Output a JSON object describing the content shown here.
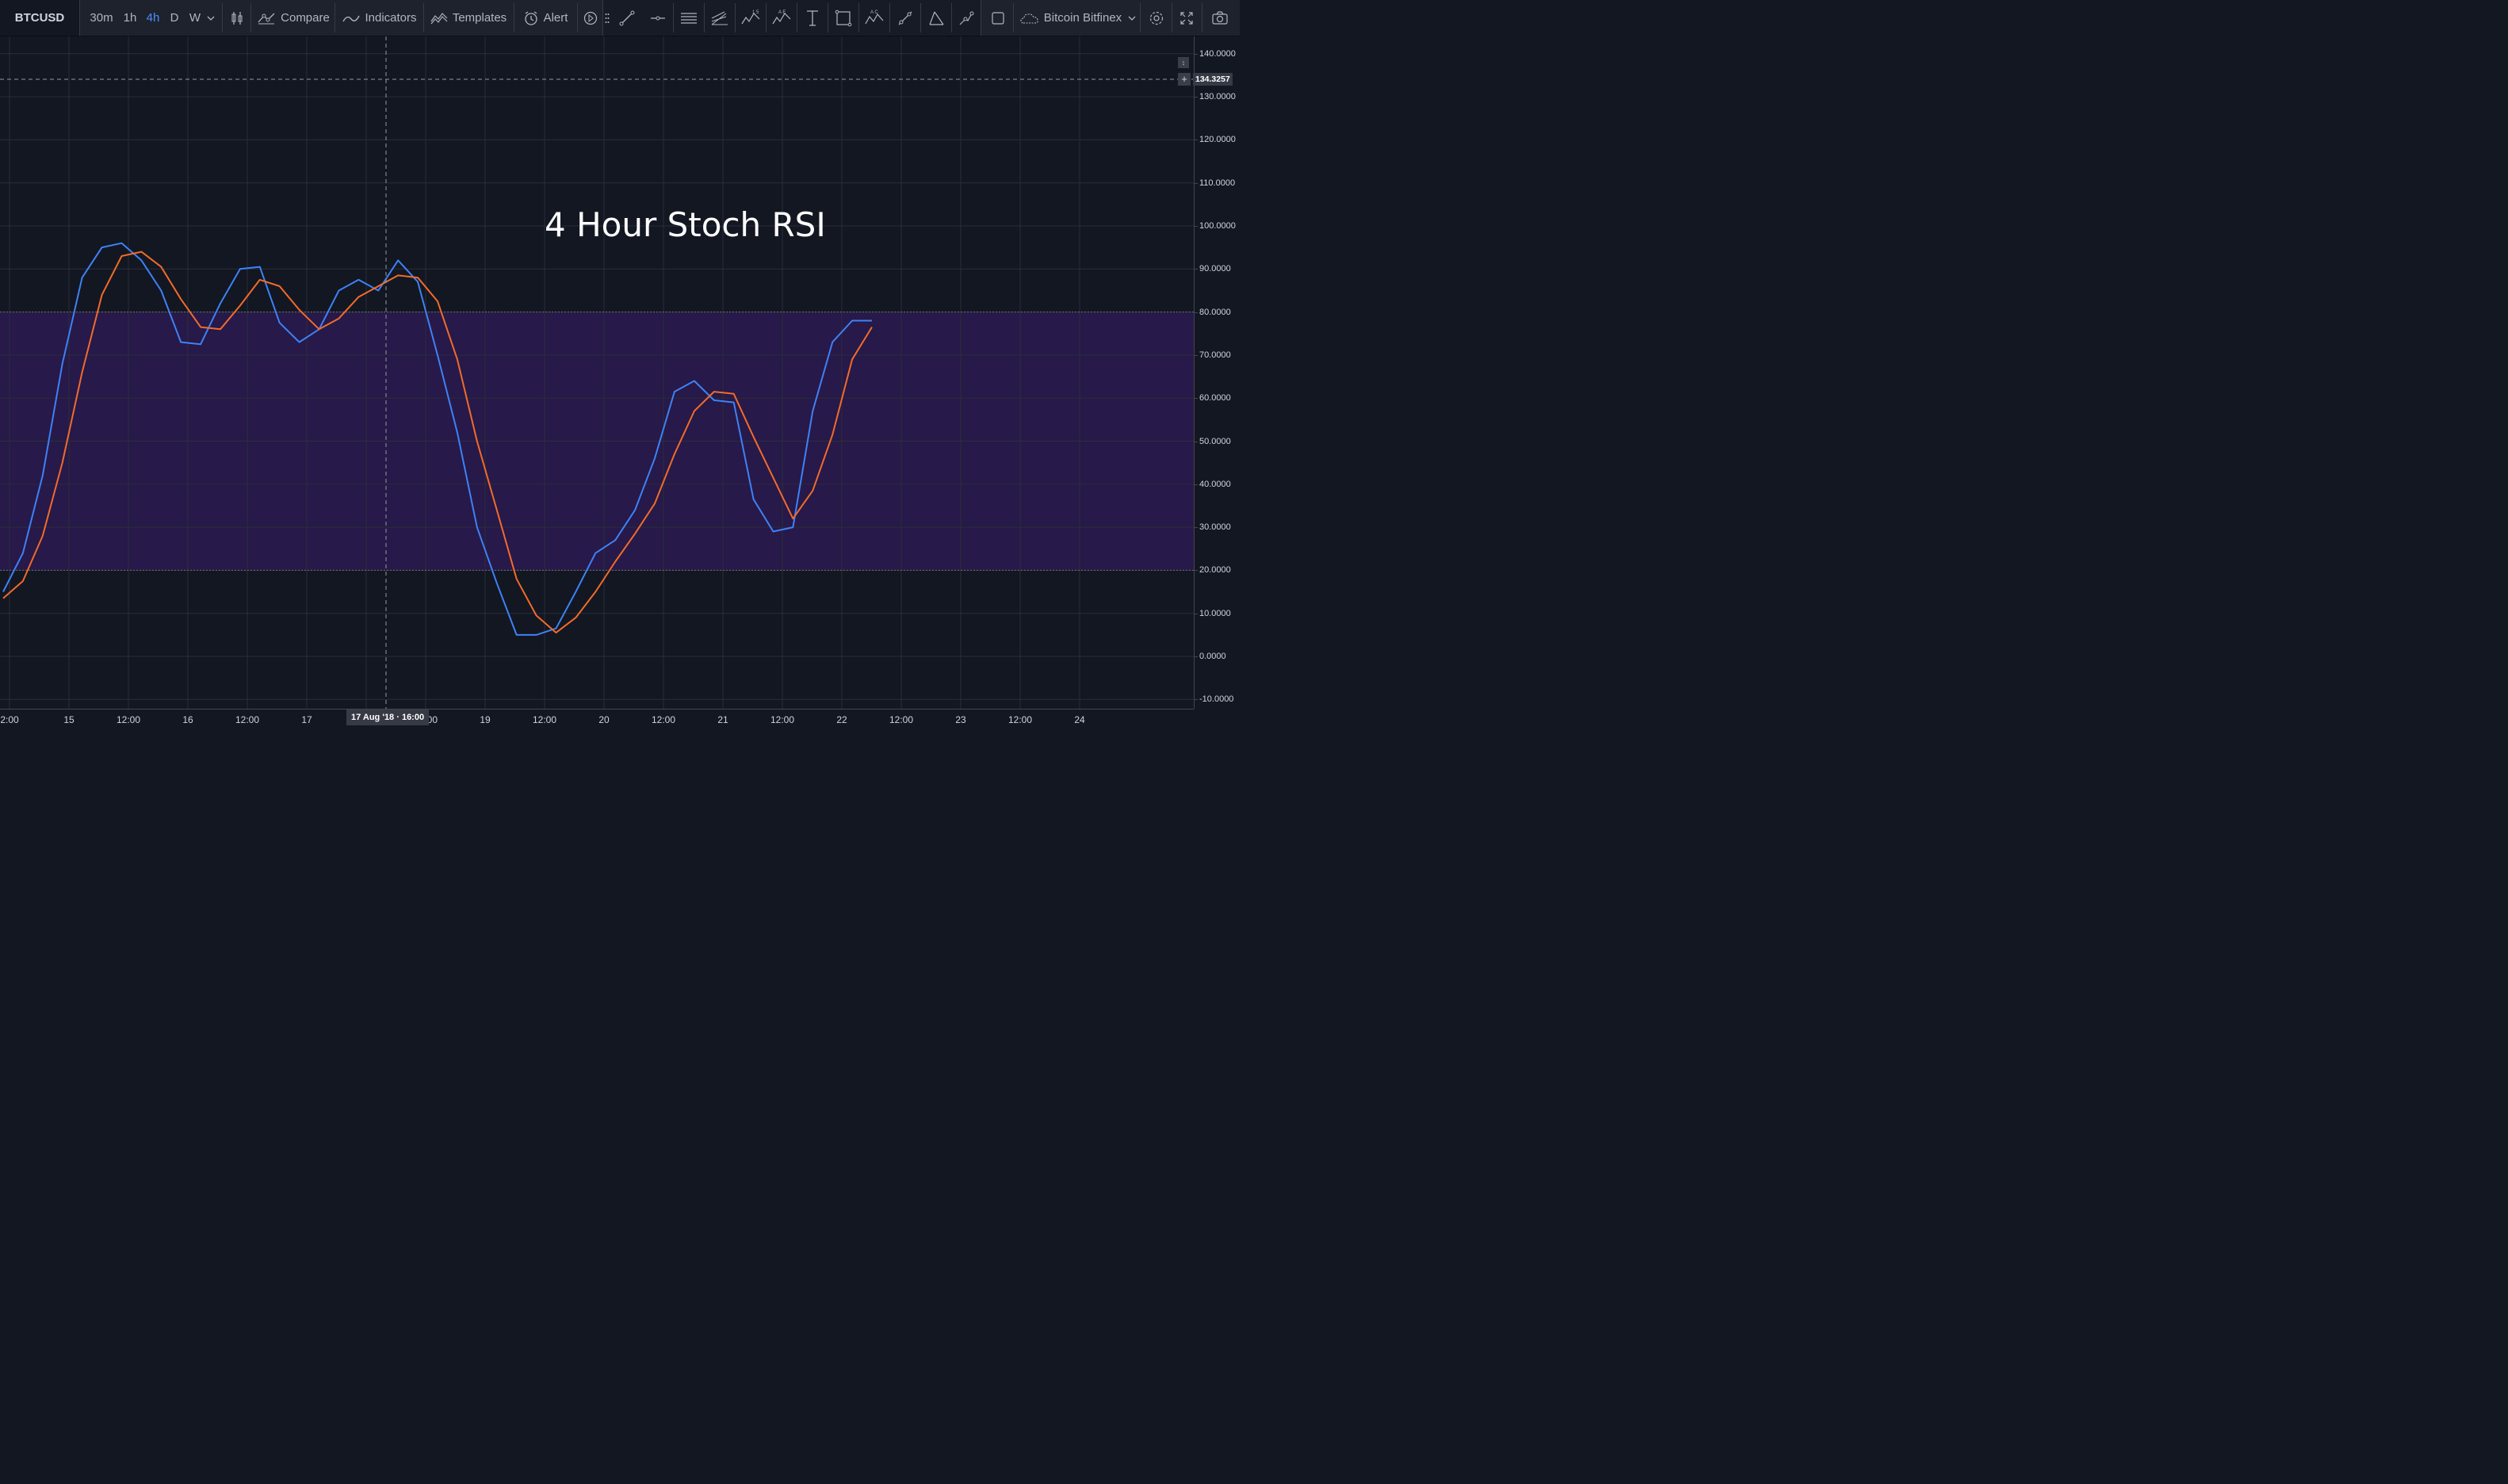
{
  "toolbar": {
    "symbol": "BTCUSD",
    "intervals": [
      "30m",
      "1h",
      "4h",
      "D",
      "W"
    ],
    "active_interval": "4h",
    "compare_label": "Compare",
    "indicators_label": "Indicators",
    "templates_label": "Templates",
    "alert_label": "Alert",
    "exchange_label": "Bitcoin Bitfinex"
  },
  "colors": {
    "background": "#131722",
    "toolbar": "#1e222d",
    "band_fill": "#2a1a4e",
    "k_line": "#3d82f7",
    "d_line": "#f26b2a",
    "active": "#4c8dff"
  },
  "crosshair": {
    "price_label": "134.3257",
    "time_label": "17 Aug '18 · 16:00"
  },
  "chart_data": {
    "type": "line",
    "title": "4 Hour Stoch RSI",
    "ylim": [
      -12,
      148
    ],
    "y_ticks": [
      "140.0000",
      "130.0000",
      "120.0000",
      "110.0000",
      "100.0000",
      "90.0000",
      "80.0000",
      "70.0000",
      "60.0000",
      "50.0000",
      "40.0000",
      "30.0000",
      "20.0000",
      "10.0000",
      "0.0000",
      "-10.0000"
    ],
    "bands": [
      {
        "from": 20,
        "to": 80
      }
    ],
    "x_tick_labels": [
      "2:00",
      "15",
      "12:00",
      "16",
      "12:00",
      "17",
      "8",
      "12:00",
      "19",
      "12:00",
      "20",
      "12:00",
      "21",
      "12:00",
      "22",
      "12:00",
      "23",
      "12:00",
      "24"
    ],
    "series": [
      {
        "values": [
          15,
          24,
          42,
          68,
          88,
          95,
          96,
          92,
          85,
          73,
          72.5,
          82,
          90,
          90.5,
          77.5,
          73,
          76,
          85,
          87.5,
          85,
          92,
          87,
          70,
          52,
          30,
          17,
          5,
          5,
          6.5,
          15,
          24,
          27,
          34,
          46,
          61.5,
          64,
          59.5,
          59,
          36.5,
          29,
          30,
          57,
          73,
          78,
          78
        ]
      },
      {
        "values": [
          13.5,
          17.5,
          28,
          45,
          66,
          84,
          93,
          94,
          90.5,
          83,
          76.5,
          76,
          81.5,
          87.5,
          86,
          80.5,
          76,
          78.5,
          83.5,
          86,
          88.5,
          88,
          82.5,
          69,
          50,
          34,
          18,
          9.5,
          5.5,
          9,
          15,
          22,
          28.5,
          35.5,
          47,
          57,
          61.5,
          61,
          51,
          41.5,
          32,
          38.5,
          51.5,
          69,
          76.5
        ]
      }
    ]
  }
}
